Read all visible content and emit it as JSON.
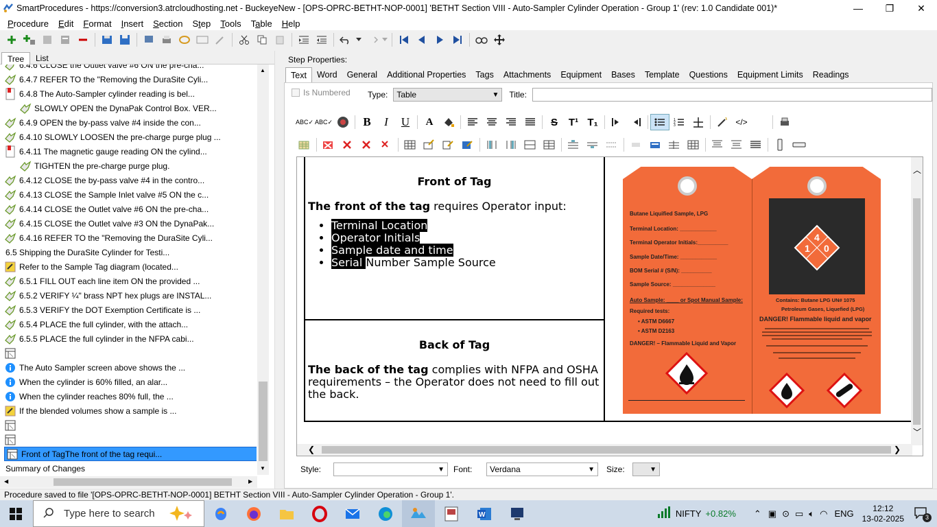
{
  "window": {
    "title": "SmartProcedures - https://conversion3.atrcloudhosting.net - BuckeyeNew - [OPS-OPRC-BETHT-NOP-0001] 'BETHT Section VIII - Auto-Sampler Cylinder Operation - Group 1' (rev: 1.0 Candidate 001)*",
    "minimize": "—",
    "maximize": "❐",
    "close": "✕"
  },
  "menu": [
    {
      "pre": "",
      "u": "P",
      "post": "rocedure"
    },
    {
      "pre": "",
      "u": "E",
      "post": "dit"
    },
    {
      "pre": "",
      "u": "F",
      "post": "ormat"
    },
    {
      "pre": "",
      "u": "I",
      "post": "nsert"
    },
    {
      "pre": "",
      "u": "S",
      "post": "ection"
    },
    {
      "pre": "S",
      "u": "t",
      "post": "ep"
    },
    {
      "pre": "",
      "u": "T",
      "post": "ools"
    },
    {
      "pre": "T",
      "u": "a",
      "post": "ble"
    },
    {
      "pre": "",
      "u": "H",
      "post": "elp"
    }
  ],
  "left": {
    "tabs": [
      "Tree",
      "List"
    ],
    "tree": [
      {
        "text": "6.4.6 CLOSE the Outlet valve #6 ON the pre-cha...",
        "icon": "step",
        "indent": 0
      },
      {
        "text": "6.4.7 REFER TO the \"Removing the DuraSite Cyli...",
        "icon": "step",
        "indent": 0
      },
      {
        "text": "6.4.8 The Auto-Sampler cylinder reading is bel...",
        "icon": "record",
        "indent": 0
      },
      {
        "text": "SLOWLY OPEN the DynaPak Control Box. VER...",
        "icon": "step",
        "indent": 1
      },
      {
        "text": "6.4.9 OPEN the by-pass valve #4 inside the con...",
        "icon": "step",
        "indent": 0
      },
      {
        "text": "6.4.10 SLOWLY LOOSEN the pre-charge purge plug ...",
        "icon": "step",
        "indent": 0
      },
      {
        "text": "6.4.11 The magnetic gauge reading ON the cylind...",
        "icon": "record",
        "indent": 0
      },
      {
        "text": "TIGHTEN the pre-charge purge plug.",
        "icon": "step",
        "indent": 1
      },
      {
        "text": "6.4.12 CLOSE the by-pass valve #4 in the contro...",
        "icon": "step",
        "indent": 0
      },
      {
        "text": "6.4.13 CLOSE the Sample Inlet valve #5 ON the c...",
        "icon": "step",
        "indent": 0
      },
      {
        "text": "6.4.14 CLOSE the Outlet valve #6 ON the pre-cha...",
        "icon": "step",
        "indent": 0
      },
      {
        "text": "6.4.15 CLOSE the Outlet valve #3 ON the DynaPak...",
        "icon": "step",
        "indent": 0
      },
      {
        "text": "6.4.16 REFER TO the \"Removing the DuraSite Cyli...",
        "icon": "step",
        "indent": 0
      },
      {
        "text": "6.5 Shipping the DuraSite Cylinder for Testi...",
        "icon": "none",
        "indent": 0
      },
      {
        "text": "Refer to the Sample Tag diagram (located...",
        "icon": "note",
        "indent": 0
      },
      {
        "text": "6.5.1 FILL OUT each line item ON the provided ...",
        "icon": "step",
        "indent": 0
      },
      {
        "text": "6.5.2 VERIFY ¼\" brass NPT hex plugs are INSTAL...",
        "icon": "step",
        "indent": 0
      },
      {
        "text": "6.5.3 VERIFY the DOT Exemption Certificate is ...",
        "icon": "step",
        "indent": 0
      },
      {
        "text": "6.5.4 PLACE the full cylinder, with the attach...",
        "icon": "step",
        "indent": 0
      },
      {
        "text": "6.5.5 PLACE the full cylinder in the NFPA cabi...",
        "icon": "step",
        "indent": 0
      },
      {
        "text": "",
        "icon": "table",
        "indent": 0
      },
      {
        "text": "The Auto Sampler screen above shows the ...",
        "icon": "info",
        "indent": 0
      },
      {
        "text": "When the cylinder is 60% filled, an alar...",
        "icon": "info",
        "indent": 0
      },
      {
        "text": "When the cylinder reaches 80% full, the ...",
        "icon": "info",
        "indent": 0
      },
      {
        "text": "If the blended volumes show a sample is ...",
        "icon": "note",
        "indent": 0
      },
      {
        "text": "",
        "icon": "table",
        "indent": 0
      },
      {
        "text": "",
        "icon": "table",
        "indent": 0
      },
      {
        "text": "Front of TagThe front of the tag requi...",
        "icon": "table",
        "indent": 0,
        "selected": true
      },
      {
        "text": "Summary of Changes",
        "icon": "none",
        "indent": 0
      }
    ]
  },
  "right": {
    "step_properties": "Step Properties:",
    "tabs": [
      "Text",
      "Word",
      "General",
      "Additional Properties",
      "Tags",
      "Attachments",
      "Equipment",
      "Bases",
      "Template",
      "Questions",
      "Equipment Limits",
      "Readings"
    ],
    "is_numbered": "Is Numbered",
    "type_label": "Type:",
    "type_value": "Table",
    "title_label": "Title:",
    "title_value": "",
    "style_label": "Style:",
    "style_value": "",
    "font_label": "Font:",
    "font_value": "Verdana",
    "size_label": "Size:",
    "size_value": ""
  },
  "doc": {
    "front_heading": "Front of Tag",
    "front_bold": "The front of the tag",
    "front_rest": " requires Operator input:",
    "bullets": [
      {
        "hl": "Terminal Location ",
        "rest": ""
      },
      {
        "hl": "Operator Initials ",
        "rest": ""
      },
      {
        "hl": "Sample date and time ",
        "rest": ""
      },
      {
        "hl": "Serial ",
        "rest": "Number Sample Source"
      }
    ],
    "back_heading": "Back of Tag",
    "back_bold": "The back of the tag",
    "back_rest": " complies with NFPA and OSHA requirements – the Operator does not need to fill out the back.",
    "tag_front": {
      "title": "Butane Liquified Sample, LPG",
      "fields": [
        "Terminal Location: ____________",
        "Terminal Operator Initials:__________",
        "Sample Date/Time: ____________",
        "BOM Serial # (S/N): __________",
        "Sample Source: ______________"
      ],
      "auto": "Auto Sample: ____ or Spot Manual Sample:",
      "req": "Required tests:",
      "tests": [
        "ASTM D6667",
        "ASTM D2163"
      ],
      "danger": "DANGER! – Flammable Liquid and Vapor"
    },
    "tag_back": {
      "contains": "Contains: Butane LPG  UN# 1075",
      "petro": "Petroleum Gases, Liquefied (LPG)",
      "danger": "DANGER! Flammable liquid and vapor",
      "nfpa": [
        "1",
        "4",
        "0"
      ]
    }
  },
  "status": "Procedure saved to file '[OPS-OPRC-BETHT-NOP-0001] BETHT Section VIII - Auto-Sampler Cylinder Operation - Group 1'.",
  "taskbar": {
    "search": "Type here to search",
    "nifty": "NIFTY",
    "nifty_change": "+0.82%",
    "lang": "ENG",
    "time": "12:12",
    "date": "13-02-2025",
    "notif": "3"
  },
  "colors": {
    "tag_orange": "#f26b3a",
    "selection": "#3399ff",
    "nifty_green": "#0a7a2a"
  }
}
